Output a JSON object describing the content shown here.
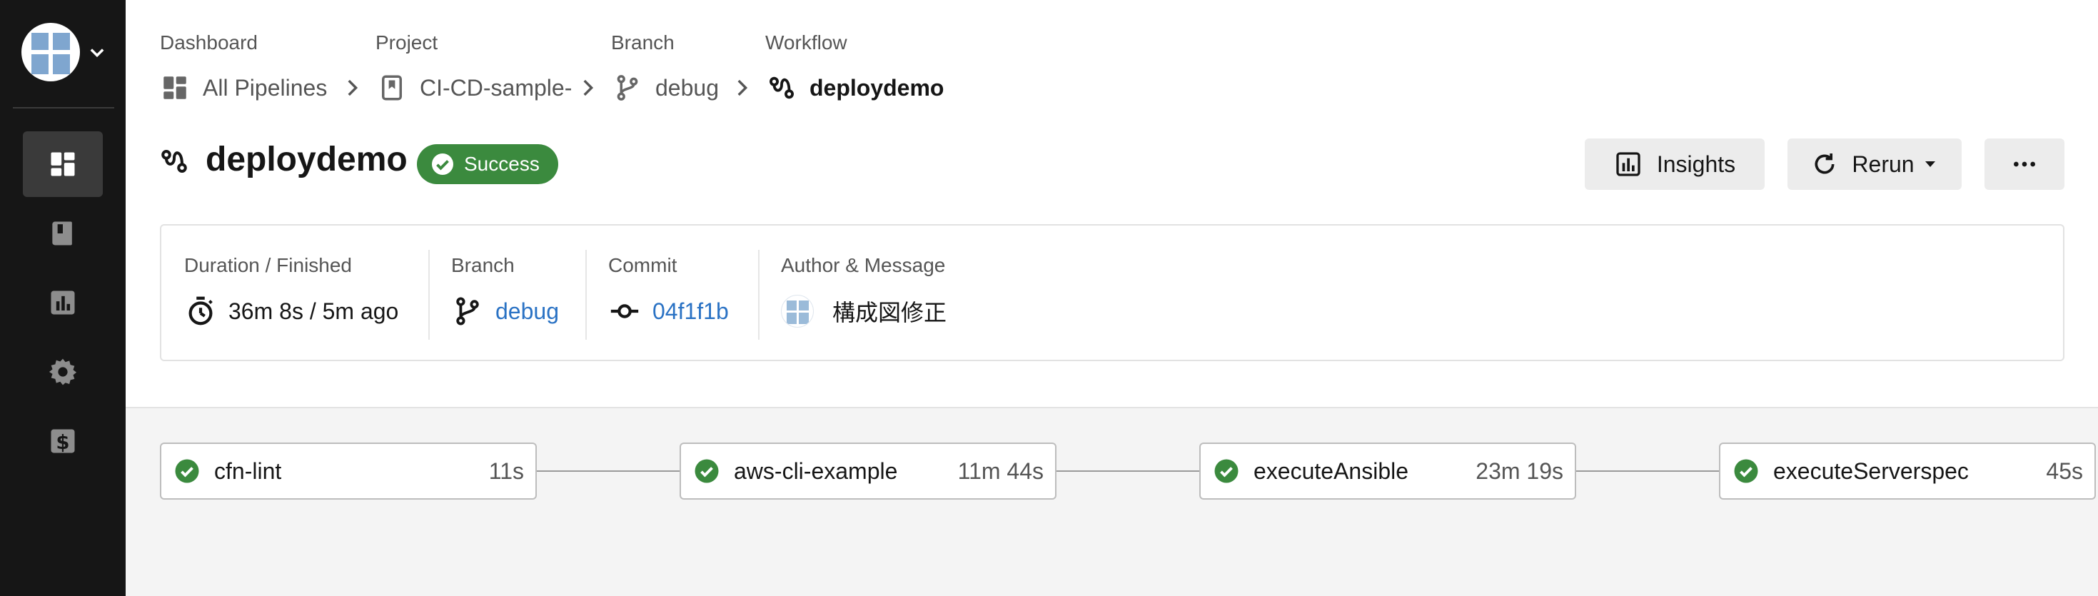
{
  "colors": {
    "sidebar_bg": "#161616",
    "success_green": "#3b8a3e",
    "link_blue": "#2a72c4",
    "canvas_bg": "#f4f4f4"
  },
  "sidebar": {
    "avatar_icon": "user-avatar",
    "items": [
      {
        "icon": "dashboard-icon",
        "active": true
      },
      {
        "icon": "book-icon",
        "active": false
      },
      {
        "icon": "bar-chart-icon",
        "active": false
      },
      {
        "icon": "gear-icon",
        "active": false
      },
      {
        "icon": "dollar-icon",
        "active": false
      }
    ]
  },
  "breadcrumb": {
    "dashboard": {
      "label": "Dashboard",
      "value": "All Pipelines"
    },
    "project": {
      "label": "Project",
      "value": "CI-CD-sample-"
    },
    "branch": {
      "label": "Branch",
      "value": "debug"
    },
    "workflow": {
      "label": "Workflow",
      "value": "deploydemo"
    }
  },
  "header": {
    "title": "deploydemo",
    "status": "Success",
    "insights_label": "Insights",
    "rerun_label": "Rerun",
    "more_icon": "ellipsis-icon"
  },
  "info": {
    "duration_label": "Duration / Finished",
    "duration_value": "36m 8s / 5m ago",
    "branch_label": "Branch",
    "branch_value": "debug",
    "commit_label": "Commit",
    "commit_value": "04f1f1b",
    "author_label": "Author & Message",
    "message": "構成図修正"
  },
  "jobs": [
    {
      "name": "cfn-lint",
      "duration": "11s",
      "status": "success"
    },
    {
      "name": "aws-cli-example",
      "duration": "11m 44s",
      "status": "success"
    },
    {
      "name": "executeAnsible",
      "duration": "23m 19s",
      "status": "success"
    },
    {
      "name": "executeServerspec",
      "duration": "45s",
      "status": "success"
    }
  ]
}
